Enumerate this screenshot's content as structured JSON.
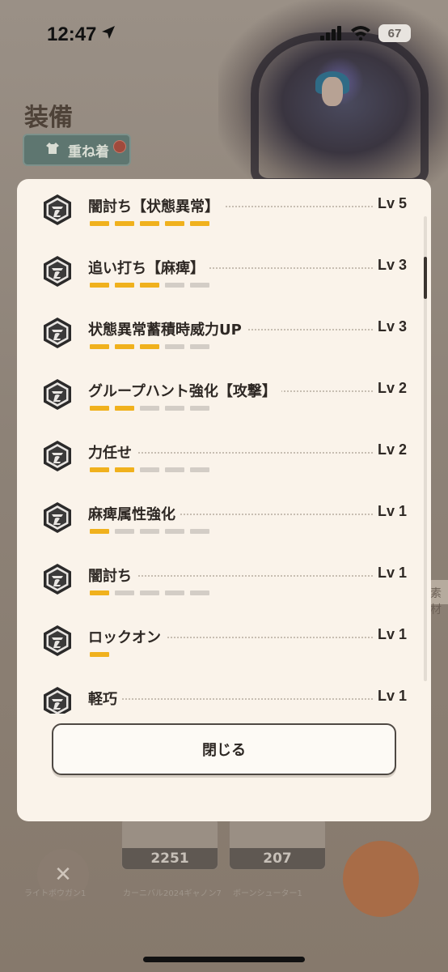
{
  "status_bar": {
    "time": "12:47",
    "battery": "67"
  },
  "background": {
    "title": "装備",
    "layer_button": "重ね着",
    "side_tag": "素材",
    "cards": [
      {
        "count": "2251",
        "label": "カーニバル2024ギャノン7"
      },
      {
        "count": "207",
        "label": "ボーンシューター1"
      }
    ],
    "left_label": "ライトボウガン1"
  },
  "skills": [
    {
      "name": "闇討ち【状態異常】",
      "level": "Lv 5",
      "filled": 5,
      "max": 5
    },
    {
      "name": "追い打ち【麻痺】",
      "level": "Lv 3",
      "filled": 3,
      "max": 5
    },
    {
      "name": "状態異常蓄積時威力UP",
      "level": "Lv 3",
      "filled": 3,
      "max": 5
    },
    {
      "name": "グループハント強化【攻撃】",
      "level": "Lv 2",
      "filled": 2,
      "max": 5
    },
    {
      "name": "力任せ",
      "level": "Lv 2",
      "filled": 2,
      "max": 5
    },
    {
      "name": "麻痺属性強化",
      "level": "Lv 1",
      "filled": 1,
      "max": 5
    },
    {
      "name": "闇討ち",
      "level": "Lv 1",
      "filled": 1,
      "max": 5
    },
    {
      "name": "ロックオン",
      "level": "Lv 1",
      "filled": 1,
      "max": 1
    },
    {
      "name": "軽巧",
      "level": "Lv 1",
      "filled": 1,
      "max": 5
    }
  ],
  "close_button": "閉じる",
  "colors": {
    "accent": "#f0b11d",
    "bar_empty": "#d3cdc6",
    "modal_bg": "#faf3ea"
  },
  "icons": {
    "skill": "skill-gem-icon"
  }
}
